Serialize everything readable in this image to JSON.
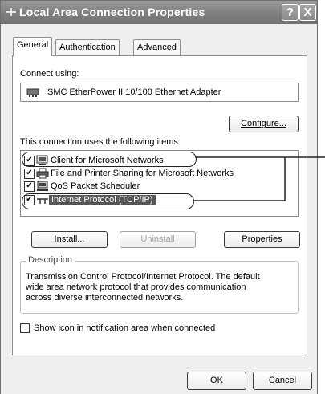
{
  "window": {
    "title": "Local Area Connection Properties",
    "help_label": "?",
    "close_label": "X"
  },
  "tabs": [
    {
      "label": "General"
    },
    {
      "label": "Authentication"
    },
    {
      "label": "Advanced"
    }
  ],
  "connect_using": {
    "label": "Connect using:",
    "adapter": "SMC EtherPower II 10/100 Ethernet Adapter",
    "configure_label": "Configure..."
  },
  "items_section": {
    "label": "This connection uses the following items:",
    "items": [
      {
        "label": "Client for Microsoft Networks",
        "checked": true,
        "icon": "network-client-icon"
      },
      {
        "label": "File and Printer Sharing for Microsoft Networks",
        "checked": true,
        "icon": "printer-icon"
      },
      {
        "label": "QoS Packet Scheduler",
        "checked": true,
        "icon": "scheduler-icon"
      },
      {
        "label": "Internet Protocol (TCP/IP)",
        "checked": true,
        "icon": "protocol-icon",
        "selected": true
      }
    ]
  },
  "buttons": {
    "install": "Install...",
    "uninstall": "Uninstall",
    "properties": "Properties",
    "ok": "OK",
    "cancel": "Cancel"
  },
  "description": {
    "legend": "Description",
    "lines": [
      "Transmission Control Protocol/Internet Protocol. The default",
      "wide area network protocol that provides communication",
      "across diverse interconnected networks."
    ]
  },
  "show_icon": {
    "label": "Show icon in notification area when connected",
    "checked": false
  }
}
